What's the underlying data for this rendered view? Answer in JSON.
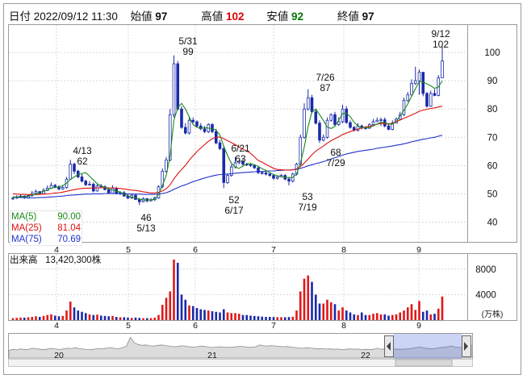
{
  "header": {
    "date_label": "日付",
    "datetime": "2022/09/12 11:30",
    "open_label": "始値",
    "open": "97",
    "high_label": "高値",
    "high": "102",
    "low_label": "安値",
    "low": "92",
    "close_label": "終値",
    "close": "97",
    "colors": {
      "high": "#dd0000",
      "low": "#007700",
      "close": "#111111"
    }
  },
  "ma_legend": [
    {
      "label": "MA(5)",
      "value": "90.00",
      "color": "#1a8a1a"
    },
    {
      "label": "MA(25)",
      "value": "81.04",
      "color": "#dd1111"
    },
    {
      "label": "MA(75)",
      "value": "70.69",
      "color": "#2233cc"
    }
  ],
  "volume_header": {
    "label": "出来高",
    "value": "13,420,300株"
  },
  "chart_data": [
    {
      "type": "candlestick",
      "y_ticks": [
        40,
        50,
        60,
        70,
        80,
        90,
        100
      ],
      "ylim": [
        33,
        110
      ],
      "x_ticks": [
        "4",
        "5",
        "6",
        "7",
        "8",
        "9"
      ],
      "up_color": "#ffffff",
      "down_color": "#1a2aa8",
      "annotations": [
        {
          "date": "4/13",
          "value": "62",
          "position": "above"
        },
        {
          "date": "5/13",
          "value": "46",
          "position": "below"
        },
        {
          "date": "5/31",
          "value": "99",
          "position": "above"
        },
        {
          "date": "6/21",
          "value": "63",
          "position": "above"
        },
        {
          "date": "6/17",
          "value": "52",
          "position": "below"
        },
        {
          "date": "7/19",
          "value": "53",
          "position": "below"
        },
        {
          "date": "7/26",
          "value": "87",
          "position": "above"
        },
        {
          "date": "7/29",
          "value": "68",
          "position": "below"
        },
        {
          "date": "9/12",
          "value": "102",
          "position": "above"
        }
      ],
      "close": [
        48.5,
        48.8,
        49.2,
        48.6,
        49.4,
        50.2,
        50.8,
        50.1,
        51.2,
        52.0,
        53.0,
        52.5,
        51.7,
        52.2,
        55.2,
        60.5,
        58.0,
        56.0,
        54.5,
        53.2,
        53.4,
        51.0,
        52.8,
        52.5,
        51.5,
        50.2,
        52.0,
        50.0,
        50.4,
        49.2,
        48.5,
        49.5,
        48.0,
        47.2,
        48.3,
        47.5,
        47.9,
        48.5,
        52.5,
        58.0,
        62.0,
        78.0,
        96.0,
        80.0,
        73.5,
        71.5,
        76.0,
        75.5,
        74.0,
        73.0,
        72.0,
        74.5,
        72.0,
        68.0,
        66.0,
        54.0,
        56.5,
        59.5,
        61.0,
        61.5,
        60.5,
        60.3,
        60.0,
        59.2,
        57.5,
        57.4,
        57.0,
        56.5,
        55.5,
        56.0,
        56.5,
        55.2,
        54.5,
        57.0,
        60.5,
        70.0,
        80.0,
        84.0,
        79.0,
        75.0,
        69.0,
        70.0,
        76.0,
        78.0,
        74.5,
        75.5,
        80.0,
        75.2,
        73.5,
        72.5,
        74.0,
        73.3,
        73.2,
        74.5,
        75.5,
        76.0,
        76.2,
        74.0,
        72.8,
        75.0,
        76.4,
        78.0,
        83.0,
        85.0,
        89.0,
        90.0,
        93.0,
        85.5,
        81.0,
        85.5,
        84.8,
        91.0,
        97.0
      ],
      "open": [
        48.2,
        48.5,
        48.8,
        49.2,
        48.6,
        49.4,
        50.2,
        50.8,
        50.1,
        51.2,
        52.0,
        53.0,
        52.5,
        51.7,
        52.2,
        55.2,
        60.5,
        58.0,
        56.0,
        54.5,
        53.2,
        53.4,
        51.0,
        52.8,
        52.5,
        51.5,
        50.2,
        52.0,
        50.0,
        50.4,
        49.2,
        48.5,
        49.5,
        48.0,
        47.2,
        48.3,
        47.5,
        47.9,
        48.5,
        52.5,
        58.0,
        62.0,
        78.0,
        96.0,
        80.0,
        73.5,
        71.5,
        76.0,
        75.5,
        74.0,
        73.0,
        72.0,
        74.5,
        72.0,
        68.0,
        66.0,
        54.0,
        56.5,
        59.5,
        61.0,
        61.5,
        60.5,
        60.3,
        60.0,
        59.2,
        57.5,
        57.4,
        57.0,
        56.5,
        55.5,
        56.0,
        56.5,
        55.2,
        54.5,
        57.0,
        60.5,
        70.0,
        80.0,
        84.0,
        79.0,
        75.0,
        69.0,
        70.0,
        76.0,
        78.0,
        74.5,
        75.5,
        80.0,
        75.2,
        73.5,
        72.5,
        74.0,
        73.3,
        73.2,
        74.5,
        75.5,
        76.0,
        76.2,
        74.0,
        72.8,
        75.0,
        76.4,
        78.0,
        83.0,
        85.0,
        89.0,
        90.0,
        93.0,
        85.5,
        81.0,
        85.5,
        84.8,
        91.0
      ],
      "high": [
        49,
        49.5,
        49.8,
        49.5,
        49.8,
        51,
        51.5,
        51,
        52,
        53,
        54,
        53.5,
        53,
        53,
        56,
        62,
        61,
        58.5,
        57,
        55,
        54.5,
        54,
        53.5,
        53.5,
        53,
        52,
        53,
        52.5,
        51,
        51,
        50,
        50,
        50,
        48.5,
        48.8,
        48.5,
        48.5,
        49,
        53,
        59,
        63,
        80,
        99,
        97,
        81,
        75,
        77,
        77,
        76,
        75,
        74,
        75,
        75,
        73,
        69,
        67,
        57,
        60.5,
        63,
        62,
        62.5,
        61,
        61,
        60.5,
        59.5,
        58,
        58,
        57.5,
        57,
        56.5,
        57,
        57,
        56,
        57.5,
        61,
        71,
        82,
        87,
        85,
        80,
        76,
        71,
        77,
        78.5,
        79,
        77,
        81.5,
        81,
        76,
        74,
        75,
        74.5,
        74,
        75,
        76.5,
        77,
        77,
        77,
        75,
        76,
        77,
        79,
        84,
        86,
        90.5,
        95,
        94,
        93,
        86,
        86.5,
        87,
        92,
        102
      ],
      "low": [
        47.8,
        48.2,
        48.5,
        48.2,
        48.3,
        49,
        50,
        49.8,
        50,
        51,
        52,
        52,
        51.3,
        51.5,
        51.8,
        55,
        57,
        55.5,
        54,
        52.8,
        52.9,
        50.5,
        50.8,
        52.2,
        51.2,
        50,
        50,
        49.8,
        49.5,
        49,
        48.2,
        48.2,
        47.8,
        46,
        47,
        47,
        47.3,
        47.5,
        48.3,
        52,
        57.5,
        61.5,
        77,
        79.5,
        73,
        71,
        71,
        75,
        73.5,
        72.5,
        71.5,
        71.5,
        71.5,
        67.5,
        65.5,
        52,
        53.5,
        56,
        59,
        60.5,
        60,
        59.8,
        59.5,
        58.8,
        57,
        56.8,
        56.5,
        56,
        55,
        55,
        55.8,
        54.8,
        53,
        54,
        56.5,
        60,
        69.5,
        79.5,
        78.5,
        74.5,
        68,
        68.5,
        69.5,
        75.5,
        74,
        74,
        75,
        74.8,
        73,
        72,
        72,
        72.8,
        72.8,
        73,
        74.8,
        75.5,
        74,
        73.5,
        72.5,
        72.5,
        75,
        76,
        77.5,
        82.5,
        84.5,
        88.5,
        85,
        84.5,
        80.5,
        80.8,
        84.5,
        84.5,
        92
      ],
      "ma5": [
        48.8,
        48.9,
        49.0,
        49.0,
        49.1,
        49.5,
        49.9,
        50.4,
        50.9,
        51.4,
        52.0,
        52.3,
        52.4,
        52.9,
        53.8,
        55.1,
        56.0,
        56.8,
        57.2,
        57.5,
        56.2,
        54.9,
        53.6,
        52.8,
        52.3,
        51.7,
        51.4,
        50.9,
        50.6,
        49.9,
        49.3,
        48.8,
        48.6,
        48.1,
        47.8,
        47.8,
        47.9,
        48.1,
        49.8,
        53.0,
        56.5,
        63.6,
        76.0,
        80.5,
        82.0,
        80.0,
        77.2,
        74.5,
        73.5,
        73.2,
        73.5,
        73.2,
        73.1,
        72.5,
        70.8,
        66.8,
        63.5,
        60.8,
        59.4,
        59.0,
        59.8,
        60.6,
        60.7,
        60.3,
        59.7,
        58.9,
        58.3,
        57.5,
        56.8,
        56.4,
        56.1,
        55.9,
        55.7,
        55.8,
        57.0,
        60.8,
        66.5,
        73.8,
        79.0,
        80.0,
        78.0,
        75.9,
        73.6,
        73.1,
        73.9,
        76.1,
        78.4,
        78.5,
        77.3,
        75.3,
        74.0,
        73.4,
        73.3,
        73.5,
        74.0,
        74.7,
        75.3,
        75.2,
        74.7,
        74.6,
        75.8,
        77.5,
        79.6,
        81.8,
        84.5,
        87.2,
        89.7,
        89.6,
        88.9,
        88.2,
        87.3,
        87.8,
        90.0
      ],
      "ma25": [
        50.0,
        49.9,
        49.8,
        49.8,
        49.7,
        49.7,
        49.7,
        49.8,
        49.9,
        50.0,
        50.1,
        50.3,
        50.4,
        50.6,
        50.9,
        51.2,
        51.5,
        51.7,
        51.9,
        52.0,
        52.0,
        52.1,
        52.1,
        52.1,
        52.2,
        52.1,
        52.1,
        52.0,
        51.9,
        51.7,
        51.5,
        51.3,
        51.2,
        51.0,
        50.7,
        50.5,
        50.3,
        50.3,
        50.5,
        51.0,
        51.8,
        53.2,
        55.3,
        57.1,
        58.6,
        60.1,
        61.9,
        63.5,
        64.9,
        66.2,
        67.4,
        68.6,
        69.5,
        70.0,
        70.1,
        69.5,
        68.8,
        68.1,
        67.4,
        66.5,
        65.8,
        65.1,
        64.3,
        63.1,
        61.8,
        61.2,
        60.4,
        59.7,
        59.0,
        58.6,
        58.5,
        58.4,
        58.4,
        58.5,
        58.8,
        59.6,
        60.9,
        62.3,
        63.8,
        65.1,
        66.0,
        66.9,
        67.9,
        68.8,
        69.5,
        70.2,
        71.0,
        71.5,
        72.0,
        72.5,
        72.9,
        73.3,
        73.6,
        73.9,
        74.2,
        74.6,
        74.9,
        74.8,
        74.7,
        75.0,
        75.5,
        76.1,
        76.7,
        77.3,
        77.9,
        78.5,
        79.2,
        79.6,
        79.9,
        80.2,
        80.4,
        80.7,
        81.0
      ],
      "ma75": [
        48.9,
        48.8,
        48.7,
        48.7,
        48.6,
        48.6,
        48.6,
        48.7,
        48.7,
        48.8,
        48.9,
        49.0,
        49.1,
        49.2,
        49.4,
        49.5,
        49.6,
        49.7,
        49.8,
        49.9,
        49.9,
        50.0,
        50.0,
        50.0,
        50.1,
        50.1,
        50.1,
        50.1,
        50.1,
        50.0,
        50.0,
        49.9,
        49.9,
        49.9,
        49.8,
        49.8,
        49.8,
        49.8,
        49.9,
        50.1,
        50.4,
        50.9,
        51.6,
        52.2,
        52.8,
        53.2,
        53.8,
        54.3,
        54.7,
        55.2,
        55.6,
        56.0,
        56.3,
        56.6,
        56.8,
        56.9,
        57.0,
        57.1,
        57.3,
        57.4,
        57.5,
        57.6,
        57.7,
        57.8,
        57.9,
        57.9,
        58.0,
        58.1,
        58.1,
        58.2,
        58.3,
        58.4,
        58.4,
        58.5,
        58.7,
        59.0,
        59.4,
        59.9,
        60.3,
        60.7,
        61.0,
        61.4,
        61.8,
        62.3,
        62.8,
        63.2,
        63.7,
        64.1,
        64.4,
        64.7,
        65.0,
        65.2,
        65.4,
        65.6,
        65.8,
        66.1,
        66.3,
        66.5,
        66.7,
        66.9,
        67.2,
        67.4,
        67.7,
        68.0,
        68.4,
        68.7,
        69.0,
        69.3,
        69.5,
        69.8,
        70.0,
        70.4,
        70.69
      ]
    },
    {
      "type": "bar",
      "title": "出来高",
      "unit_label": "(万株)",
      "y_ticks": [
        4000,
        8000
      ],
      "ylim": [
        0,
        10500
      ],
      "x_ticks": [
        "4",
        "5",
        "6",
        "7",
        "8",
        "9"
      ],
      "values": [
        300,
        350,
        400,
        380,
        450,
        500,
        600,
        500,
        650,
        800,
        900,
        700,
        600,
        650,
        1500,
        2900,
        2000,
        1500,
        1300,
        1100,
        900,
        800,
        850,
        700,
        650,
        600,
        650,
        500,
        450,
        450,
        400,
        350,
        400,
        350,
        300,
        300,
        320,
        380,
        800,
        2400,
        3500,
        4500,
        9500,
        9000,
        4000,
        3200,
        2300,
        2200,
        1900,
        1700,
        1600,
        1500,
        1400,
        1300,
        1200,
        1700,
        1200,
        1100,
        1100,
        1000,
        800,
        800,
        700,
        650,
        600,
        550,
        500,
        500,
        480,
        450,
        460,
        450,
        480,
        520,
        1500,
        4500,
        6500,
        7000,
        6000,
        4000,
        2600,
        2600,
        3200,
        2800,
        2500,
        1500,
        2000,
        1500,
        1200,
        900,
        800,
        1200,
        800,
        800,
        1000,
        1100,
        900,
        900,
        700,
        800,
        900,
        1200,
        1500,
        2000,
        2500,
        1600,
        3000,
        1300,
        1500,
        900,
        1000,
        1800,
        3700
      ],
      "down_days": [
        false,
        false,
        false,
        true,
        false,
        false,
        false,
        true,
        false,
        false,
        false,
        true,
        true,
        false,
        false,
        false,
        true,
        true,
        true,
        true,
        false,
        true,
        false,
        true,
        true,
        true,
        false,
        true,
        false,
        true,
        true,
        false,
        true,
        true,
        false,
        true,
        false,
        false,
        false,
        false,
        false,
        false,
        false,
        true,
        true,
        true,
        false,
        true,
        true,
        true,
        true,
        false,
        true,
        true,
        true,
        true,
        false,
        false,
        false,
        false,
        true,
        true,
        true,
        true,
        true,
        true,
        true,
        true,
        true,
        false,
        false,
        true,
        true,
        false,
        false,
        false,
        false,
        false,
        true,
        true,
        true,
        false,
        false,
        false,
        true,
        false,
        false,
        true,
        true,
        true,
        false,
        true,
        true,
        false,
        false,
        false,
        false,
        true,
        true,
        false,
        false,
        false,
        false,
        false,
        false,
        false,
        false,
        true,
        true,
        false,
        true,
        false,
        false
      ]
    },
    {
      "type": "area",
      "x_ticks": [
        "20",
        "21",
        "22"
      ]
    }
  ]
}
